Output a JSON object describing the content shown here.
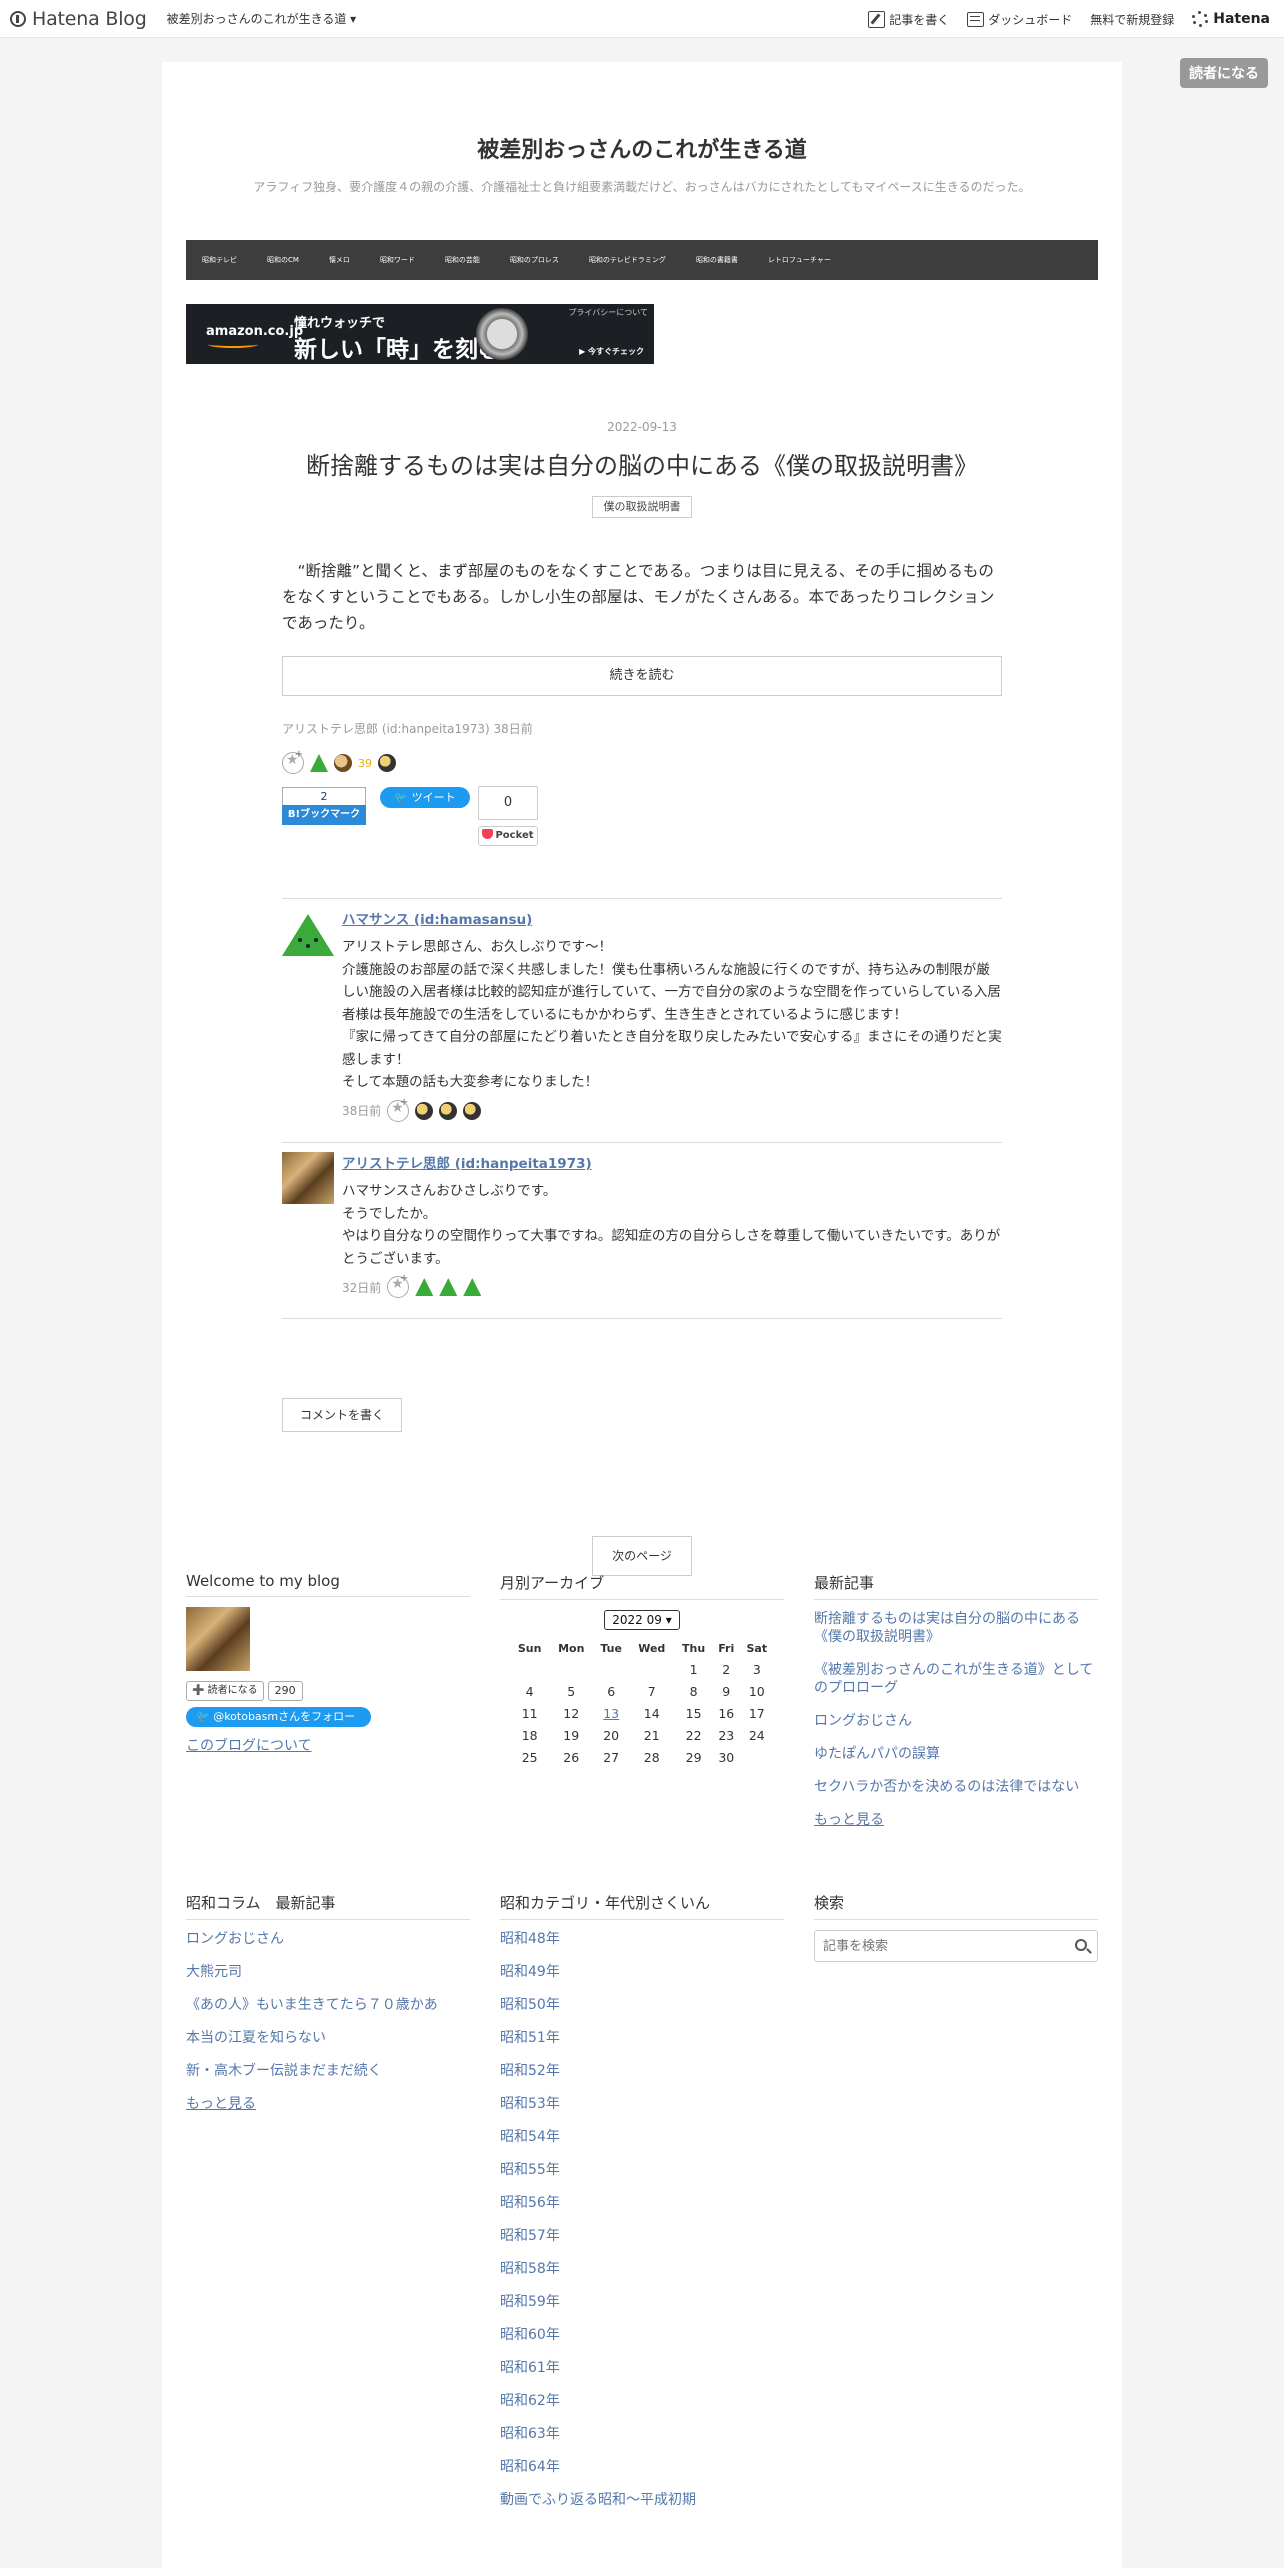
{
  "topbar": {
    "logo": "Hatena Blog",
    "blog_selector": "被差別おっさんのこれが生きる道 ▾",
    "write": "記事を書く",
    "dashboard": "ダッシュボード",
    "signup": "無料で新規登録",
    "hatena": "Hatena"
  },
  "reader_button": "読者になる",
  "blog": {
    "title": "被差別おっさんのこれが生きる道",
    "description": "アラフィフ独身、要介護度４の親の介護、介護福祉士と負け組要素満載だけど、おっさんはバカにされたとしてもマイペースに生きるのだった。"
  },
  "global_nav": [
    "昭和テレビ",
    "昭和のCM",
    "懐メロ",
    "昭和ワード",
    "昭和の芸能",
    "昭和のプロレス",
    "昭和のテレビドラミング",
    "昭和の書籍書",
    "レトロフューチャー"
  ],
  "ad": {
    "brand": "amazon.co.jp",
    "line1": "憧れウォッチで",
    "line2": "新しい「時」を刻む",
    "privacy": "プライバシーについて",
    "cta": "▶ 今すぐチェック"
  },
  "post": {
    "date": "2022-09-13",
    "title": "断捨離するものは実は自分の脳の中にある《僕の取扱説明書》",
    "category": "僕の取扱説明書",
    "body": "“断捨離”と聞くと、まず部屋のものをなくすことである。つまりは目に見える、その手に掴めるものをなくすということでもある。しかし小生の部屋は、モノがたくさんある。本であったりコレクションであったり。",
    "read_more": "続きを読む",
    "author": "アリストテレ思郎 (id:hanpeita1973)",
    "time_ago": "38日前",
    "star_count": "39",
    "bookmark_count": "2",
    "bookmark_label": "B!ブックマーク",
    "tweet_label": "ツイート",
    "pocket_count": "0",
    "pocket_label": "Pocket"
  },
  "comments": [
    {
      "name": "ハマサンス (id:hamasansu)",
      "lines": [
        "アリストテレ思郎さん、お久しぶりです～！",
        "介護施設のお部屋の話で深く共感しました！僕も仕事柄いろんな施設に行くのですが、持ち込みの制限が厳しい施設の入居者様は比較的認知症が進行していて、一方で自分の家のような空間を作っていらしている入居者様は長年施設での生活をしているにもかかわらず、生き生きとされているように感じます！",
        "『家に帰ってきて自分の部屋にたどり着いたとき自分を取り戻したみたいで安心する』まさにその通りだと実感します！",
        "そして本題の話も大変参考になりました！"
      ],
      "time": "38日前"
    },
    {
      "name": "アリストテレ思郎 (id:hanpeita1973)",
      "lines": [
        "ハマサンスさんおひさしぶりです。",
        "そうでしたか。",
        "やはり自分なりの空間作りって大事ですね。認知症の方の自分らしさを尊重して働いていきたいです。ありがとうございます。"
      ],
      "time": "32日前"
    }
  ],
  "write_comment": "コメントを書く",
  "next_page": "次のページ",
  "widgets": {
    "welcome": {
      "title": "Welcome to my blog",
      "reader_label": "➕ 読者になる",
      "reader_count": "290",
      "twitter": "@kotobasmさんをフォロー",
      "about": "このブログについて"
    },
    "archive": {
      "title": "月別アーカイブ",
      "selected": "2022 09",
      "weekdays": [
        "Sun",
        "Mon",
        "Tue",
        "Wed",
        "Thu",
        "Fri",
        "Sat"
      ],
      "weeks": [
        [
          "",
          "",
          "",
          "",
          "1",
          "2",
          "3"
        ],
        [
          "4",
          "5",
          "6",
          "7",
          "8",
          "9",
          "10"
        ],
        [
          "11",
          "12",
          "13",
          "14",
          "15",
          "16",
          "17"
        ],
        [
          "18",
          "19",
          "20",
          "21",
          "22",
          "23",
          "24"
        ],
        [
          "25",
          "26",
          "27",
          "28",
          "29",
          "30",
          ""
        ]
      ],
      "linked_day": "13"
    },
    "recent": {
      "title": "最新記事",
      "items": [
        "断捨離するものは実は自分の脳の中にある《僕の取扱説明書》",
        "《被差別おっさんのこれが生きる道》としてのプロローグ",
        "ロングおじさん",
        "ゆたぽんパパの誤算",
        "セクハラか否かを決めるのは法律ではない"
      ],
      "more": "もっと見る"
    },
    "column": {
      "title": "昭和コラム　最新記事",
      "items": [
        "ロングおじさん",
        "大熊元司",
        "《あの人》もいま生きてたら７０歳かあ",
        "本当の江夏を知らない",
        "新・高木ブー伝説まだまだ続く"
      ],
      "more": "もっと見る"
    },
    "categories": {
      "title": "昭和カテゴリ・年代別さくいん",
      "items": [
        "昭和48年",
        "昭和49年",
        "昭和50年",
        "昭和51年",
        "昭和52年",
        "昭和53年",
        "昭和54年",
        "昭和55年",
        "昭和56年",
        "昭和57年",
        "昭和58年",
        "昭和59年",
        "昭和60年",
        "昭和61年",
        "昭和62年",
        "昭和63年",
        "昭和64年",
        "動画でふり返る昭和～平成初期"
      ]
    },
    "search": {
      "title": "検索",
      "placeholder": "記事を検索"
    }
  }
}
